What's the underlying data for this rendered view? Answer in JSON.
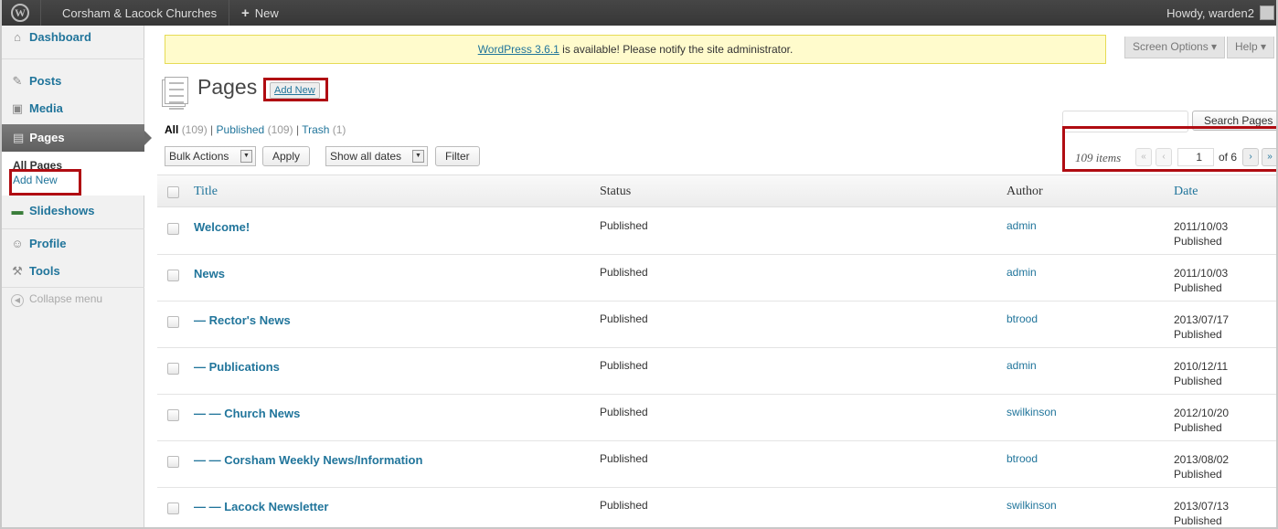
{
  "admin_bar": {
    "logo": "W",
    "site_name": "Corsham & Lacock Churches",
    "new_plus": "+",
    "new_label": "New",
    "howdy": "Howdy, warden2"
  },
  "sidebar": {
    "dashboard": "Dashboard",
    "posts": "Posts",
    "media": "Media",
    "pages": "Pages",
    "sub_all_pages": "All Pages",
    "sub_add_new": "Add New",
    "slideshows": "Slideshows",
    "profile": "Profile",
    "tools": "Tools",
    "collapse": "Collapse menu"
  },
  "notice": {
    "link": "WordPress 3.6.1",
    "text": " is available! Please notify the site administrator."
  },
  "screen_options": "Screen Options ▾",
  "help": "Help ▾",
  "header": {
    "title": "Pages",
    "add_new": "Add New"
  },
  "filters": {
    "all": "All",
    "all_count": "(109)",
    "published": "Published",
    "published_count": "(109)",
    "trash": "Trash",
    "trash_count": "(1)",
    "sep": "|"
  },
  "search_button": "Search Pages",
  "bulk_actions": "Bulk Actions",
  "apply": "Apply",
  "dates": "Show all dates",
  "filter": "Filter",
  "pagination": {
    "items": "109 items",
    "first": "«",
    "prev": "‹",
    "current": "1",
    "of": "of 6",
    "next": "›",
    "last": "»"
  },
  "columns": {
    "title": "Title",
    "status": "Status",
    "author": "Author",
    "date": "Date"
  },
  "rows": [
    {
      "title": "Welcome!",
      "status": "Published",
      "author": "admin",
      "date": "2011/10/03",
      "date_status": "Published"
    },
    {
      "title": "News",
      "status": "Published",
      "author": "admin",
      "date": "2011/10/03",
      "date_status": "Published"
    },
    {
      "title": "— Rector's News",
      "status": "Published",
      "author": "btrood",
      "date": "2013/07/17",
      "date_status": "Published"
    },
    {
      "title": "— Publications",
      "status": "Published",
      "author": "admin",
      "date": "2010/12/11",
      "date_status": "Published"
    },
    {
      "title": "— — Church News",
      "status": "Published",
      "author": "swilkinson",
      "date": "2012/10/20",
      "date_status": "Published"
    },
    {
      "title": "— — Corsham Weekly News/Information",
      "status": "Published",
      "author": "btrood",
      "date": "2013/08/02",
      "date_status": "Published"
    },
    {
      "title": "— — Lacock Newsletter",
      "status": "Published",
      "author": "swilkinson",
      "date": "2013/07/13",
      "date_status": "Published"
    }
  ]
}
